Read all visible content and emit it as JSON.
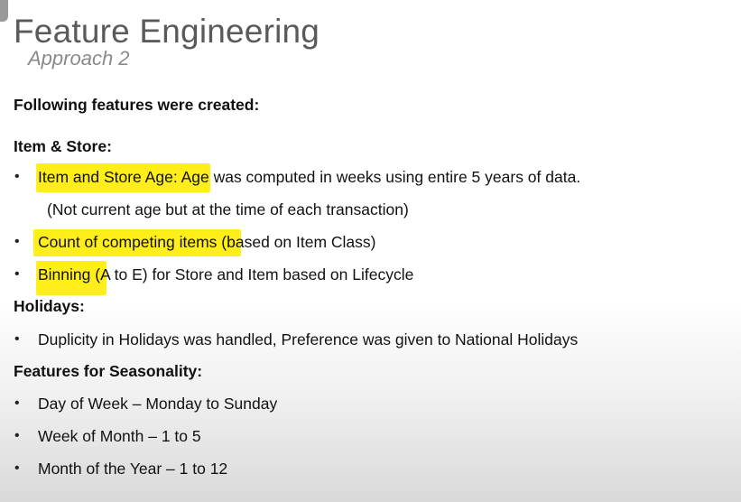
{
  "title": "Feature Engineering",
  "subtitle": "Approach 2",
  "intro": "Following features were created:",
  "sections": [
    {
      "heading": "Item & Store:",
      "items": [
        {
          "text": "Item and Store Age: Age was computed in weeks using entire 5 years of data.",
          "continuation": "(Not current age but at the time of each transaction)"
        },
        {
          "text": "Count of competing items (based on Item Class)"
        },
        {
          "text": "Binning (A to E) for Store and Item based on Lifecycle"
        }
      ]
    },
    {
      "heading": "Holidays:",
      "items": [
        {
          "text": "Duplicity in Holidays was handled, Preference was given to National Holidays"
        }
      ]
    },
    {
      "heading": "Features for Seasonality:",
      "items": [
        {
          "text": "Day of Week – Monday to Sunday"
        },
        {
          "text": "Week of Month – 1 to 5"
        },
        {
          "text": "Month of the Year – 1 to 12"
        }
      ]
    }
  ],
  "bullet_glyph": "•",
  "highlight_color": "#ffee1a"
}
